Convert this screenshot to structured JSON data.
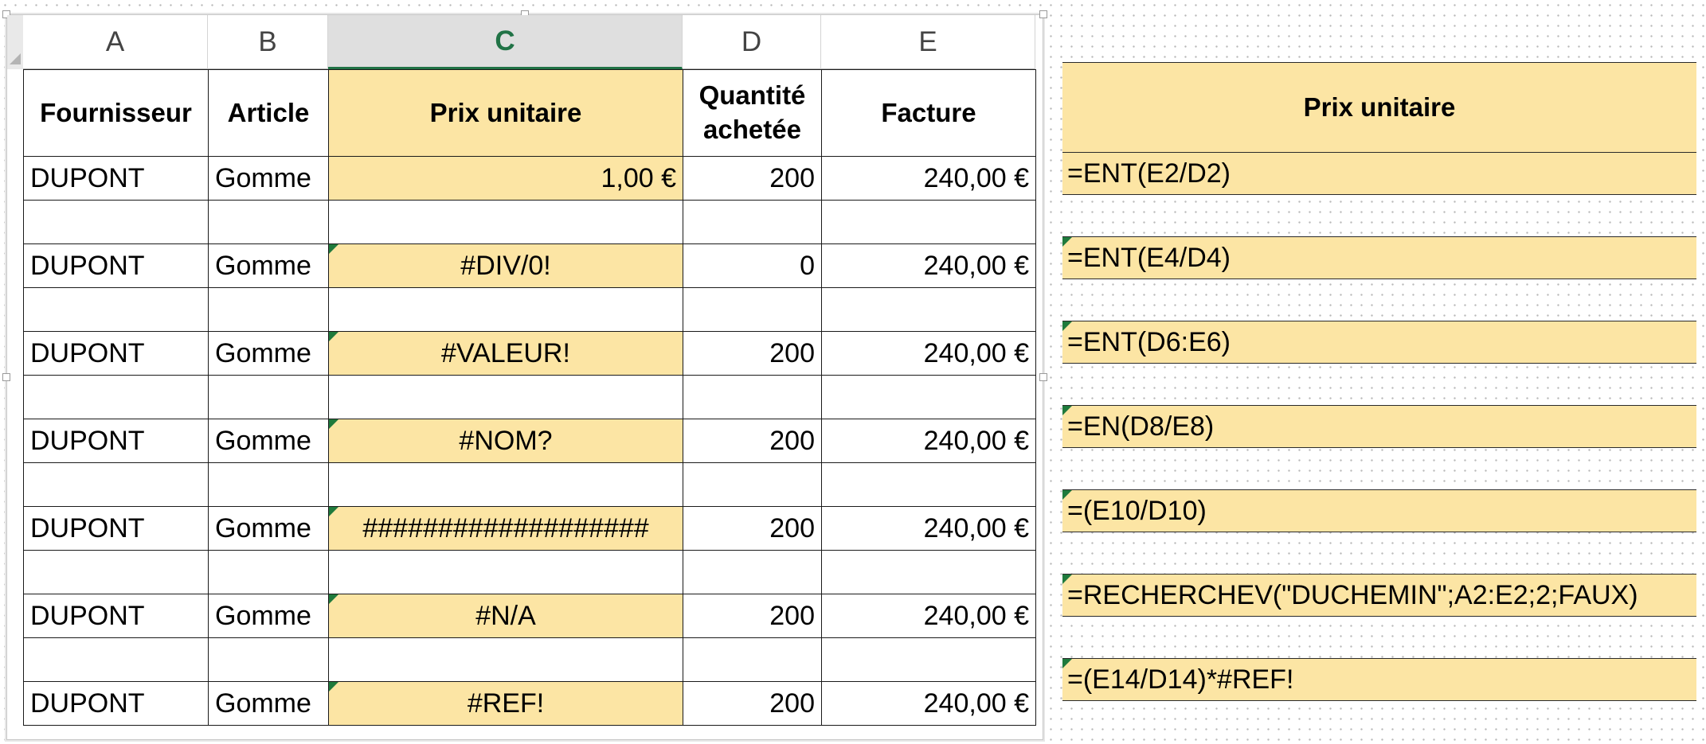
{
  "columns": [
    "A",
    "B",
    "C",
    "D",
    "E"
  ],
  "selected_column": "C",
  "headers": {
    "fournisseur": "Fournisseur",
    "article": "Article",
    "prix": "Prix unitaire",
    "quantite_line1": "Quantité",
    "quantite_line2": "achetée",
    "facture": "Facture"
  },
  "rows": [
    {
      "fournisseur": "DUPONT",
      "article": "Gomme",
      "prix": "1,00 €",
      "quantite": "200",
      "facture": "240,00 €",
      "formula": "=ENT(E2/D2)"
    },
    {
      "fournisseur": "DUPONT",
      "article": "Gomme",
      "prix": "#DIV/0!",
      "quantite": "0",
      "facture": "240,00 €",
      "formula": "=ENT(E4/D4)"
    },
    {
      "fournisseur": "DUPONT",
      "article": "Gomme",
      "prix": "#VALEUR!",
      "quantite": "200",
      "facture": "240,00 €",
      "formula": "=ENT(D6:E6)"
    },
    {
      "fournisseur": "DUPONT",
      "article": "Gomme",
      "prix": "#NOM?",
      "quantite": "200",
      "facture": "240,00 €",
      "formula": "=EN(D8/E8)"
    },
    {
      "fournisseur": "DUPONT",
      "article": "Gomme",
      "prix": "###################",
      "quantite": "200",
      "facture": "240,00 €",
      "formula": "=(E10/D10)"
    },
    {
      "fournisseur": "DUPONT",
      "article": "Gomme",
      "prix": "#N/A",
      "quantite": "200",
      "facture": "240,00 €",
      "formula": "=RECHERCHEV(\"DUCHEMIN\";A2:E2;2;FAUX)"
    },
    {
      "fournisseur": "DUPONT",
      "article": "Gomme",
      "prix": "#REF!",
      "quantite": "200",
      "facture": "240,00 €",
      "formula": "=(E14/D14)*#REF!"
    }
  ],
  "formula_panel": {
    "header": "Prix unitaire"
  },
  "colors": {
    "highlight": "#fce5a4",
    "selected_column_text": "#217346",
    "error_flag": "#1f7a3c"
  }
}
